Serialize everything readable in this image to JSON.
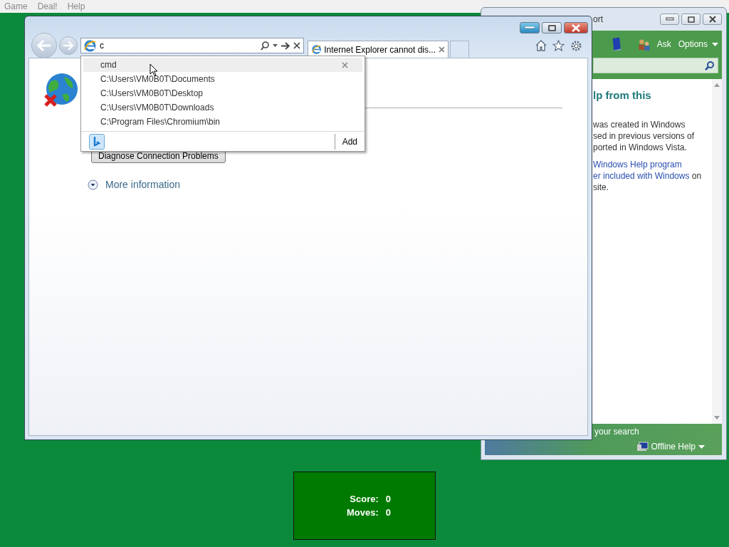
{
  "menu_bar": {
    "items": [
      "Game",
      "Deal!",
      "Help"
    ]
  },
  "help_window": {
    "title": "ort",
    "toolbar": {
      "ask": "Ask",
      "options": "Options"
    },
    "heading": "lp from this",
    "paragraphs": [
      {
        "lines": [
          {
            "segments": [
              {
                "text": "was created in Windows",
                "link": false
              }
            ]
          },
          {
            "segments": [
              {
                "text": "sed in previous versions of",
                "link": false
              }
            ]
          },
          {
            "segments": [
              {
                "text": "ported in Windows Vista.",
                "link": false
              }
            ]
          }
        ]
      },
      {
        "lines": [
          {
            "segments": [
              {
                "text": "Windows Help program",
                "link": true
              }
            ]
          },
          {
            "segments": [
              {
                "text": "er included with Windows",
                "link": true
              },
              {
                "text": " on",
                "link": false
              }
            ]
          },
          {
            "segments": [
              {
                "text": "site.",
                "link": false
              }
            ]
          }
        ]
      }
    ],
    "footer": {
      "search_hint": "your search",
      "offline_help": "Offline Help"
    }
  },
  "browser_window": {
    "address_bar": {
      "value": "c"
    },
    "tabs": [
      {
        "title": "Internet Explorer cannot dis...",
        "selected": true
      }
    ],
    "diagnose_button": "Diagnose Connection Problems",
    "more_information": "More information",
    "autocomplete": {
      "items": [
        {
          "text": "cmd",
          "selected": true
        },
        {
          "text": "C:\\Users\\VM0B0T\\Documents",
          "selected": false
        },
        {
          "text": "C:\\Users\\VM0B0T\\Desktop",
          "selected": false
        },
        {
          "text": "C:\\Users\\VM0B0T\\Downloads",
          "selected": false
        },
        {
          "text": "C:\\Program Files\\Chromium\\bin",
          "selected": false
        }
      ],
      "add_button": "Add"
    }
  },
  "score_panel": {
    "score_label": "Score:",
    "score": "0",
    "moves_label": "Moves:",
    "moves": "0"
  }
}
